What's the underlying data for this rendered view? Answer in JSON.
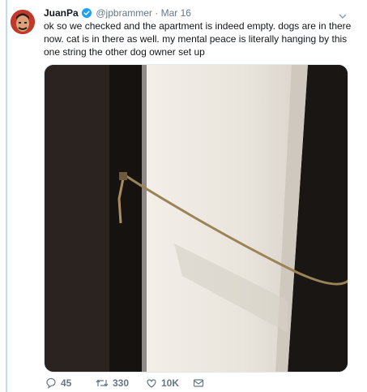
{
  "tweet": {
    "display_name": "JuanPa",
    "handle": "@jpbrammer",
    "separator": "·",
    "date": "Mar 16",
    "text": "ok so we checked and the apartment is indeed empty. dogs are in there now. cat is in there as well. my mental peace is literally hanging by this one string the other dog owner set up"
  },
  "actions": {
    "replies": "45",
    "retweets": "330",
    "likes": "10K"
  },
  "icons": {
    "verified": "verified-badge-icon",
    "menu": "chevron-down-icon",
    "reply": "reply-icon",
    "retweet": "retweet-icon",
    "like": "heart-icon",
    "message": "direct-message-icon"
  },
  "colors": {
    "accent": "#1da1f2",
    "muted": "#657786",
    "thread_line": "#c4dbee"
  }
}
